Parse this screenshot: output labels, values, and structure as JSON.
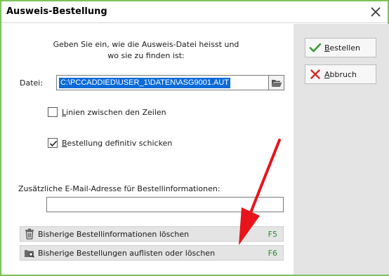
{
  "window": {
    "title": "Ausweis-Bestellung"
  },
  "instructions": {
    "line1": "Geben Sie ein, wie die Ausweis-Datei heisst und",
    "line2": "wo sie zu finden ist:"
  },
  "file": {
    "label": "Datei:",
    "value": "C:\\PCCADDIED\\USER_1\\DATEN\\ASG9001.AUT"
  },
  "options": {
    "lines_between_rows": {
      "label_first": "L",
      "label_rest": "inien zwischen den Zeilen",
      "checked": false
    },
    "order_definitive": {
      "label_first": "B",
      "label_rest": "estellung definitiv schicken",
      "checked": true
    }
  },
  "email": {
    "label": "Zusätzliche E-Mail-Adresse für Bestellinformationen:",
    "value": ""
  },
  "actions": [
    {
      "label": "Bisherige Bestellinformationen löschen",
      "key": "F5",
      "icon": "trash-icon"
    },
    {
      "label": "Bisherige Bestellungen auflisten oder löschen",
      "key": "F6",
      "icon": "folder-search-icon"
    }
  ],
  "side_buttons": {
    "order": {
      "label_first": "B",
      "label_rest": "estellen",
      "icon": "checkmark-icon"
    },
    "cancel": {
      "label_first": "A",
      "label_rest": "bbruch",
      "icon": "cross-icon"
    }
  },
  "colors": {
    "accent_border": "#7cc35a",
    "selection": "#0a6ad8",
    "hotkey": "#2a8a2a",
    "annotation_arrow": "#e8141c"
  }
}
